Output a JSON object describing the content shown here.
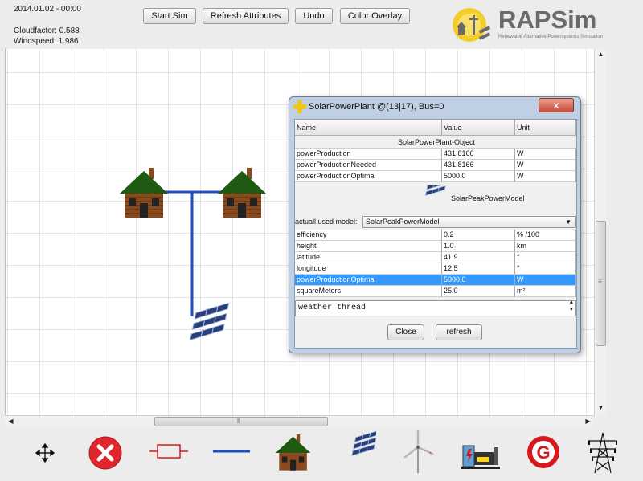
{
  "status": {
    "datetime": "2014.01.02 - 00:00",
    "cloudfactor": "Cloudfactor: 0.588",
    "windspeed": "Windspeed: 1.986"
  },
  "top_buttons": {
    "start_sim": "Start Sim",
    "refresh_attributes": "Refresh Attributes",
    "undo": "Undo",
    "color_overlay": "Color Overlay"
  },
  "logo": {
    "title": "RAPSim",
    "subtitle": "Renewable Alternative Powersystems Simulation"
  },
  "dialog": {
    "title": "SolarPowerPlant @(13|17), Bus=0",
    "close_glyph": "x",
    "headers": {
      "name": "Name",
      "value": "Value",
      "unit": "Unit"
    },
    "object_label": "SolarPowerPlant-Object",
    "base_rows": [
      {
        "name": "powerProduction",
        "value": "431.8166",
        "unit": "W"
      },
      {
        "name": "powerProductionNeeded",
        "value": "431.8166",
        "unit": "W"
      },
      {
        "name": "powerProductionOptimal",
        "value": "5000.0",
        "unit": "W"
      }
    ],
    "model_name": "SolarPeakPowerModel",
    "model_select_label": "actuall used model:",
    "model_select_value": "SolarPeakPowerModel",
    "model_rows": [
      {
        "name": "efficiency",
        "value": "0.2",
        "unit": "% /100"
      },
      {
        "name": "height",
        "value": "1.0",
        "unit": "km"
      },
      {
        "name": "latitude",
        "value": "41.9",
        "unit": "°"
      },
      {
        "name": "longitude",
        "value": "12.5",
        "unit": "°"
      },
      {
        "name": "powerProductionOptimal",
        "value": "5000.0",
        "unit": "W"
      },
      {
        "name": "squareMeters",
        "value": "25.0",
        "unit": "m²"
      }
    ],
    "textarea": "weather thread",
    "close_button": "Close",
    "refresh_button": "refresh"
  },
  "toolbar": [
    {
      "icon": "move-icon"
    },
    {
      "icon": "delete-icon"
    },
    {
      "icon": "resistor-icon"
    },
    {
      "icon": "line-icon"
    },
    {
      "icon": "house-icon"
    },
    {
      "icon": "solar-panel-icon"
    },
    {
      "icon": "wind-turbine-icon"
    },
    {
      "icon": "hydro-plant-icon"
    },
    {
      "icon": "generator-icon"
    },
    {
      "icon": "transmission-tower-icon"
    }
  ],
  "colors": {
    "line": "#1f4fc0",
    "selection": "#3399ff",
    "delete": "#e0262c",
    "generator": "#d8191c"
  }
}
